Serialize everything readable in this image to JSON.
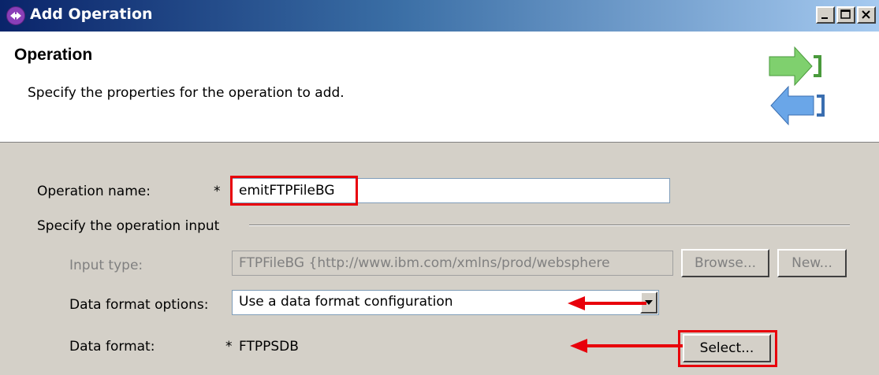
{
  "window": {
    "title": "Add Operation",
    "icon": "wizard-app-icon",
    "controls": [
      "minimize",
      "maximize",
      "close"
    ]
  },
  "header": {
    "title": "Operation",
    "description": "Specify the properties for the operation to add.",
    "graphic": "wizard-arrows-icon"
  },
  "form": {
    "operation_name": {
      "label": "Operation name:",
      "required_mark": "*",
      "value": "emitFTPFileBG"
    },
    "input_group": {
      "label": "Specify the operation input"
    },
    "input_type": {
      "label": "Input type:",
      "value": "FTPFileBG  {http://www.ibm.com/xmlns/prod/websphere",
      "browse_label": "Browse...",
      "new_label": "New..."
    },
    "data_format_options": {
      "label": "Data format options:",
      "selected": "Use a data format configuration"
    },
    "data_format": {
      "label": "Data format:",
      "required_mark": "*",
      "value": "FTPPSDB",
      "select_label": "Select..."
    }
  },
  "annotations": {
    "highlight_color": "#e8000b",
    "highlight_boxes": [
      "operation-name-field",
      "select-button"
    ],
    "arrows": [
      "data-format-options-combo",
      "data-format-value"
    ]
  }
}
